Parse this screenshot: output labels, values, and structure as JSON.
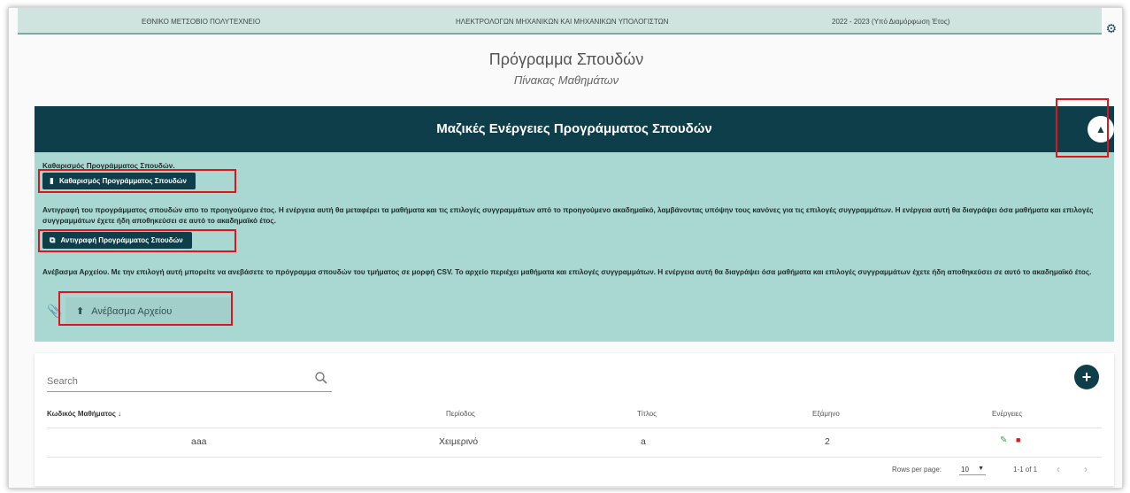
{
  "header": {
    "university": "ΕΘΝΙΚΟ ΜΕΤΣΟΒΙΟ ΠΟΛΥΤΕΧΝΕΙΟ",
    "school": "ΗΛΕΚΤΡΟΛΟΓΩΝ ΜΗΧΑΝΙΚΩΝ ΚΑΙ ΜΗΧΑΝΙΚΩΝ ΥΠΟΛΟΓΙΣΤΩΝ",
    "year": "2022 - 2023 (Υπό Διαμόρφωση Έτος)",
    "settings_icon": "gear-icon"
  },
  "page": {
    "title": "Πρόγραμμα Σπουδών",
    "subtitle": "Πίνακας Μαθημάτων"
  },
  "bulk_panel": {
    "title": "Μαζικές Ενέργειες Προγράμματος Σπουδών",
    "collapse_icon": "chevron-up-icon",
    "clear_text": "Καθαρισμός Προγράμματος Σπουδών.",
    "clear_button": "Καθαρισμός Προγράμματος Σπουδών",
    "copy_text": "Αντιγραφή του προγράμματος σπουδών απο το προηγούμενο έτος. Η ενέργεια αυτή θα μεταφέρει τα μαθήματα και τις επιλογές συγγραμμάτων από το προηγούμενο ακαδημαϊκό, λαμβάνοντας υπόψην τους κανόνες για τις επιλογές συγγραμμάτων. Η ενέργεια αυτή θα διαγράψει όσα μαθήματα και επιλογές συγγραμμάτων έχετε ήδη αποθηκεύσει σε αυτό το ακαδημαϊκό έτος.",
    "copy_button": "Αντιγραφή Προγράμματος Σπουδών",
    "upload_text": "Ανέβασμα Αρχείου. Με την επιλογή αυτή μπορείτε να ανεβάσετε το πρόγραμμα σπουδών του τμήματος σε μορφή CSV. Το αρχείο περιέχει μαθήματα και επιλογές συγγραμμάτων. Η ενέργεια αυτή θα διαγράψει όσα μαθήματα και επιλογές συγγραμμάτων έχετε ήδη αποθηκεύσει σε αυτό το ακαδημαϊκό έτος.",
    "upload_button": "Ανέβασμα Αρχείου"
  },
  "table": {
    "search_placeholder": "Search",
    "columns": [
      "Κωδικός Μαθήματος",
      "Περίοδος",
      "Τίτλος",
      "Εξάμηνο",
      "Ενέργειες"
    ],
    "sort_indicator": "↓",
    "rows": [
      {
        "code": "aaa",
        "period": "Χειμερινό",
        "title": "a",
        "semester": "2"
      }
    ],
    "footer": {
      "rows_per_page_label": "Rows per page:",
      "rows_per_page_value": "10",
      "range": "1-1 of 1"
    }
  },
  "colors": {
    "accent_dark": "#0e3e4a",
    "panel_bg": "#a9d8d2",
    "highlight": "#e0141b",
    "edit": "#3aa04a"
  }
}
